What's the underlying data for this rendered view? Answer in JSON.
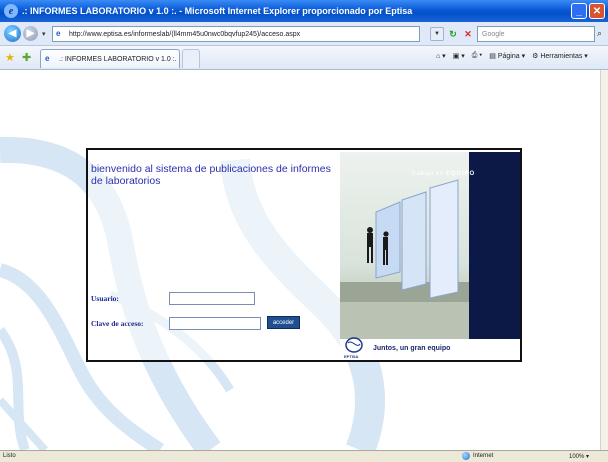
{
  "window": {
    "title": ".: INFORMES LABORATORIO v 1.0 :. - Microsoft Internet Explorer proporcionado por Eptisa"
  },
  "addressbar": {
    "url": "http://www.eptisa.es/informeslab/(ll4mm45u0nwc0bqvfup245)/acceso.aspx",
    "search_placeholder": "Google"
  },
  "tabbar": {
    "tab_title": ".: INFORMES LABORATORIO v 1.0 :.",
    "commands": [
      "Página",
      "Herramientas"
    ]
  },
  "login": {
    "welcome": "bienvenido al sistema de publicaciones de informes de laboratorios",
    "user_label": "Usuario:",
    "user_value": "",
    "password_label": "Clave de acceso:",
    "password_value": "",
    "submit_label": "acceder"
  },
  "promo": {
    "tagline_prefix": "trabajo en",
    "tagline_emphasis": "EQUIPO",
    "logo_text": "EPTISA",
    "slogan": "Juntos, un gran equipo"
  },
  "statusbar": {
    "status": "Listo",
    "zone": "Internet",
    "zoom": "100%"
  },
  "colors": {
    "accent": "#2a2fae",
    "promo_bar": "#0c1947",
    "button": "#1f4f8f"
  }
}
